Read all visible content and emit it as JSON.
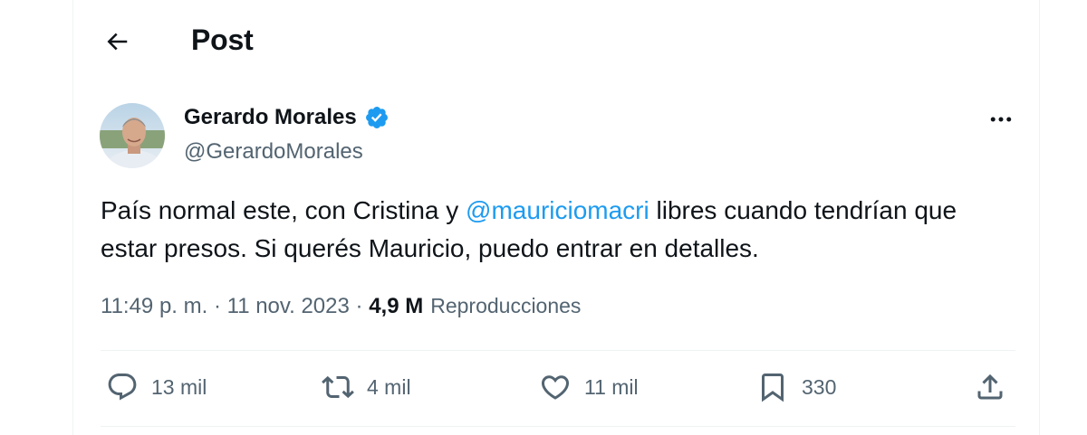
{
  "header": {
    "title": "Post",
    "back_icon": "arrow-left-icon"
  },
  "author": {
    "name": "Gerardo Morales",
    "handle": "@GerardoMorales",
    "verified_icon": "verified-badge-icon",
    "verified_color": "#1d9bf0"
  },
  "post": {
    "text_before": "País normal este, con Cristina y ",
    "mention": "@mauriciomacri",
    "text_after": " libres cuando tendrían que estar presos. Si querés Mauricio, puedo entrar en detalles."
  },
  "meta": {
    "time": "11:49 p. m.",
    "sep1": " · ",
    "date": "11 nov. 2023",
    "sep2": " · ",
    "views": "4,9 M",
    "views_label": "Reproducciones"
  },
  "actions": {
    "replies": "13 mil",
    "reposts": "4 mil",
    "likes": "11 mil",
    "bookmarks": "330"
  },
  "colors": {
    "accent": "#1d9bf0",
    "text_primary": "#0f1419",
    "text_secondary": "#536471",
    "divider": "#eff3f4"
  }
}
